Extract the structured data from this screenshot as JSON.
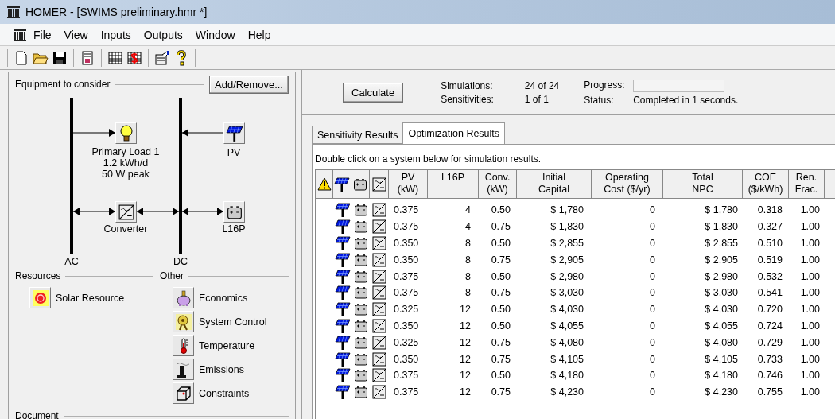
{
  "window": {
    "title": "HOMER - [SWIMS preliminary.hmr *]"
  },
  "menu": [
    "File",
    "View",
    "Inputs",
    "Outputs",
    "Window",
    "Help"
  ],
  "equipment": {
    "title": "Equipment to consider",
    "button": "Add/Remove...",
    "nodes": [
      {
        "kind": "load",
        "lines": [
          "Primary Load 1",
          "1.2 kWh/d",
          "50 W peak"
        ]
      },
      {
        "kind": "pv",
        "lines": [
          "PV"
        ]
      },
      {
        "kind": "converter",
        "lines": [
          "Converter"
        ]
      },
      {
        "kind": "battery",
        "lines": [
          "L16P"
        ]
      }
    ],
    "buses": [
      "AC",
      "DC"
    ]
  },
  "resources": {
    "title": "Resources",
    "items": [
      {
        "kind": "solar",
        "label": "Solar Resource"
      }
    ]
  },
  "other": {
    "title": "Other",
    "items": [
      {
        "kind": "economics",
        "label": "Economics"
      },
      {
        "kind": "control",
        "label": "System Control"
      },
      {
        "kind": "temperature",
        "label": "Temperature"
      },
      {
        "kind": "emissions",
        "label": "Emissions"
      },
      {
        "kind": "constraints",
        "label": "Constraints"
      }
    ]
  },
  "document": {
    "title": "Document"
  },
  "run": {
    "button": "Calculate",
    "simulations_label": "Simulations:",
    "simulations": "24 of 24",
    "sensitivities_label": "Sensitivities:",
    "sensitivities": "1 of 1",
    "progress_label": "Progress:",
    "progress": {
      "level": 0
    },
    "status_label": "Status:",
    "status": "Completed in 1 seconds."
  },
  "tabs": [
    {
      "label": "Sensitivity Results",
      "selected": false
    },
    {
      "label": "Optimization Results",
      "selected": true
    }
  ],
  "hint": "Double click on a system below for simulation results.",
  "table": {
    "columns": [
      "PV\n(kW)",
      "L16P",
      "Conv.\n(kW)",
      "Initial\nCapital",
      "Operating\nCost ($/yr)",
      "Total\nNPC",
      "COE\n($/kWh)",
      "Ren.\nFrac."
    ],
    "rows": [
      [
        "0.375",
        "4",
        "0.50",
        "$ 1,780",
        "0",
        "$ 1,780",
        "0.318",
        "1.00"
      ],
      [
        "0.375",
        "4",
        "0.75",
        "$ 1,830",
        "0",
        "$ 1,830",
        "0.327",
        "1.00"
      ],
      [
        "0.350",
        "8",
        "0.50",
        "$ 2,855",
        "0",
        "$ 2,855",
        "0.510",
        "1.00"
      ],
      [
        "0.350",
        "8",
        "0.75",
        "$ 2,905",
        "0",
        "$ 2,905",
        "0.519",
        "1.00"
      ],
      [
        "0.375",
        "8",
        "0.50",
        "$ 2,980",
        "0",
        "$ 2,980",
        "0.532",
        "1.00"
      ],
      [
        "0.375",
        "8",
        "0.75",
        "$ 3,030",
        "0",
        "$ 3,030",
        "0.541",
        "1.00"
      ],
      [
        "0.325",
        "12",
        "0.50",
        "$ 4,030",
        "0",
        "$ 4,030",
        "0.720",
        "1.00"
      ],
      [
        "0.350",
        "12",
        "0.50",
        "$ 4,055",
        "0",
        "$ 4,055",
        "0.724",
        "1.00"
      ],
      [
        "0.325",
        "12",
        "0.75",
        "$ 4,080",
        "0",
        "$ 4,080",
        "0.729",
        "1.00"
      ],
      [
        "0.350",
        "12",
        "0.75",
        "$ 4,105",
        "0",
        "$ 4,105",
        "0.733",
        "1.00"
      ],
      [
        "0.375",
        "12",
        "0.50",
        "$ 4,180",
        "0",
        "$ 4,180",
        "0.746",
        "1.00"
      ],
      [
        "0.375",
        "12",
        "0.75",
        "$ 4,230",
        "0",
        "$ 4,230",
        "0.755",
        "1.00"
      ]
    ]
  }
}
